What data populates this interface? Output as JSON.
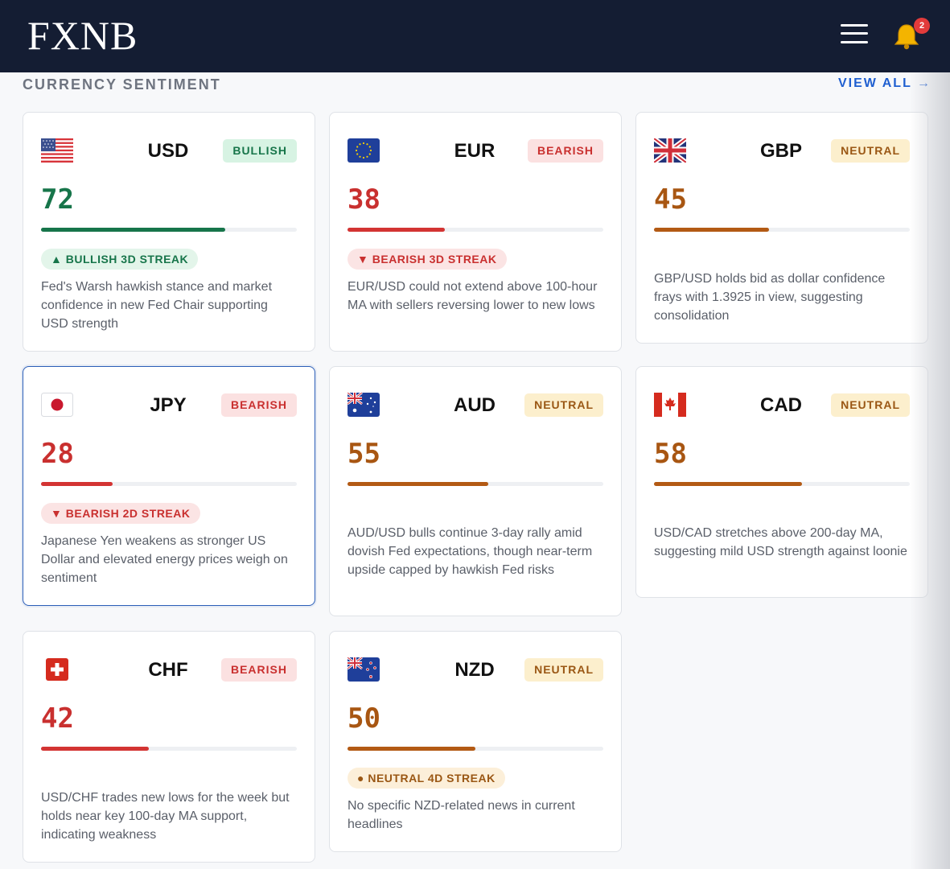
{
  "header": {
    "logo_text": "FXNB",
    "menu_icon": "hamburger-menu-icon",
    "notification_icon": "bell-icon",
    "notification_count": "2"
  },
  "section": {
    "title": "CURRENCY SENTIMENT",
    "view_all": "VIEW ALL →"
  },
  "colors": {
    "header_bg": "#141d33",
    "bullish": "#17754a",
    "bearish": "#c9302f",
    "neutral": "#a85612",
    "link": "#1f5fd0"
  },
  "cards": [
    {
      "code": "USD",
      "flag": "us-flag-icon",
      "sentiment": "BULLISH",
      "score": "72",
      "score_value": 72,
      "streak": "▲ BULLISH 3D STREAK",
      "description": "Fed's Warsh hawkish stance and market confidence in new Fed Chair supporting USD strength"
    },
    {
      "code": "EUR",
      "flag": "eu-flag-icon",
      "sentiment": "BEARISH",
      "score": "38",
      "score_value": 38,
      "streak": "▼ BEARISH 3D STREAK",
      "description": "EUR/USD could not extend above 100-hour MA with sellers reversing lower to new lows"
    },
    {
      "code": "GBP",
      "flag": "uk-flag-icon",
      "sentiment": "NEUTRAL",
      "score": "45",
      "score_value": 45,
      "streak": "",
      "description": "GBP/USD holds bid as dollar confidence frays with 1.3925 in view, suggesting consolidation"
    },
    {
      "code": "JPY",
      "flag": "japan-flag-icon",
      "sentiment": "BEARISH",
      "score": "28",
      "score_value": 28,
      "streak": "▼ BEARISH 2D STREAK",
      "description": "Japanese Yen weakens as stronger US Dollar and elevated energy prices weigh on sentiment"
    },
    {
      "code": "AUD",
      "flag": "australia-flag-icon",
      "sentiment": "NEUTRAL",
      "score": "55",
      "score_value": 55,
      "streak": "",
      "description": "AUD/USD bulls continue 3-day rally amid dovish Fed expectations, though near-term upside capped by hawkish Fed risks"
    },
    {
      "code": "CAD",
      "flag": "canada-flag-icon",
      "sentiment": "NEUTRAL",
      "score": "58",
      "score_value": 58,
      "streak": "",
      "description": "USD/CAD stretches above 200-day MA, suggesting mild USD strength against loonie"
    },
    {
      "code": "CHF",
      "flag": "switzerland-flag-icon",
      "sentiment": "BEARISH",
      "score": "42",
      "score_value": 42,
      "streak": "",
      "description": "USD/CHF trades new lows for the week but holds near key 100-day MA support, indicating weakness"
    },
    {
      "code": "NZD",
      "flag": "new-zealand-flag-icon",
      "sentiment": "NEUTRAL",
      "score": "50",
      "score_value": 50,
      "streak": "● NEUTRAL 4D STREAK",
      "description": "No specific NZD-related news in current headlines"
    }
  ]
}
